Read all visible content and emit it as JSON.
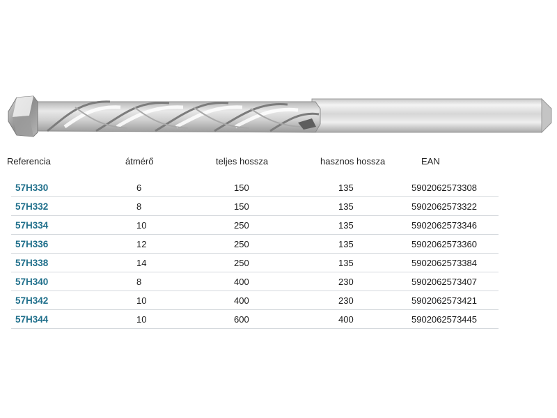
{
  "headers": {
    "reference": "Referencia",
    "diameter": "átmérő",
    "total_length": "teljes hossza",
    "usable_length": "hasznos hossza",
    "ean": "EAN"
  },
  "rows": [
    {
      "ref": "57H330",
      "diameter": "6",
      "total": "150",
      "usable": "135",
      "ean": "5902062573308"
    },
    {
      "ref": "57H332",
      "diameter": "8",
      "total": "150",
      "usable": "135",
      "ean": "5902062573322"
    },
    {
      "ref": "57H334",
      "diameter": "10",
      "total": "250",
      "usable": "135",
      "ean": "5902062573346"
    },
    {
      "ref": "57H336",
      "diameter": "12",
      "total": "250",
      "usable": "135",
      "ean": "5902062573360"
    },
    {
      "ref": "57H338",
      "diameter": "14",
      "total": "250",
      "usable": "135",
      "ean": "5902062573384"
    },
    {
      "ref": "57H340",
      "diameter": "8",
      "total": "400",
      "usable": "230",
      "ean": "5902062573407"
    },
    {
      "ref": "57H342",
      "diameter": "10",
      "total": "400",
      "usable": "230",
      "ean": "5902062573421"
    },
    {
      "ref": "57H344",
      "diameter": "10",
      "total": "600",
      "usable": "400",
      "ean": "5902062573445"
    }
  ],
  "colors": {
    "reference_text": "#1f6f8b",
    "row_divider": "#d5d9dd"
  }
}
